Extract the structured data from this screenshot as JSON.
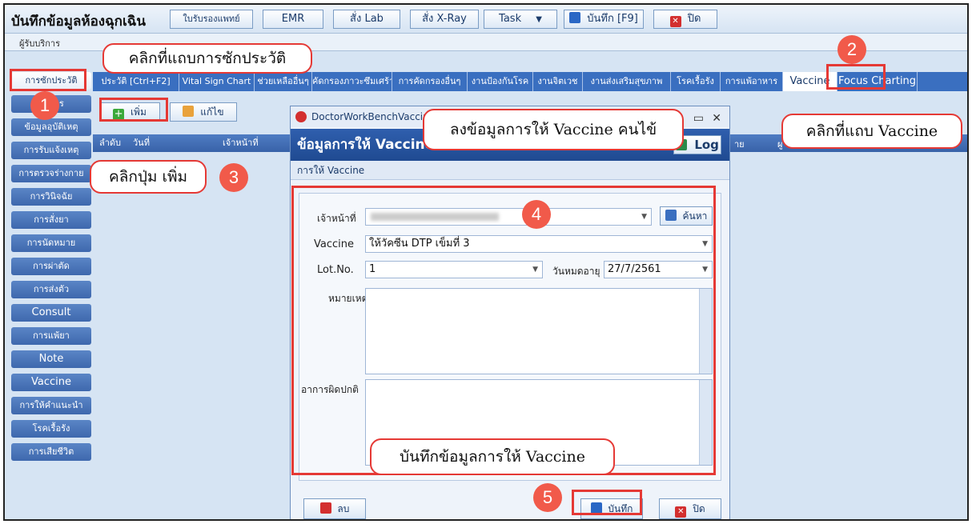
{
  "toolbar": {
    "title": "บันทึกข้อมูลห้องฉุกเฉิน",
    "buttons": [
      "ใบรับรองแพทย์",
      "EMR",
      "สั่ง Lab",
      "สั่ง X-Ray",
      "Task",
      "บันทึก [F9]",
      "ปิด"
    ]
  },
  "subrow": {
    "label": "ผู้รับบริการ"
  },
  "tabs": [
    "ประวัติ [Ctrl+F2]",
    "Vital Sign Chart",
    "ช่วยเหลืออื่นๆ",
    "คัดกรองภาวะซึมเศร้า",
    "การคัดกรองอื่นๆ",
    "งานป้องกันโรค",
    "งานจิตเวช",
    "งานส่งเสริมสุขภาพ",
    "โรคเรื้อรัง",
    "การแพ้อาหาร",
    "Vaccine",
    "Focus Charting"
  ],
  "sidebar": [
    "การซักประวัติ",
    "อาการ",
    "ข้อมูลอุบัติเหตุ",
    "การรับแจ้งเหตุ",
    "การตรวจร่างกาย",
    "การวินิจฉัย",
    "การสั่งยา",
    "การนัดหมาย",
    "การผ่าตัด",
    "การส่งตัว",
    "Consult",
    "การแพ้ยา",
    "Note",
    "Vaccine",
    "การให้คำแนะนำ",
    "โรคเรื้อรัง",
    "การเสียชีวิต"
  ],
  "left_panel": {
    "add_label": "เพิ่ม",
    "edit_label": "แก้ไข",
    "columns": [
      "ลำดับ",
      "วันที่",
      "เจ้าหน้าที่"
    ]
  },
  "dialog": {
    "window_title": "DoctorWorkBenchVaccine",
    "header": "ข้อมูลการให้ Vaccine",
    "log_label": "Log",
    "section": "การให้ Vaccine",
    "staff_label": "เจ้าหน้าที่",
    "search_label": "ค้นหา",
    "vaccine_label": "Vaccine",
    "vaccine_value": "ให้วัคซีน DTP เข็มที่ 3",
    "lot_label": "Lot.No.",
    "lot_value": "1",
    "expiry_label": "วันหมดอายุ",
    "expiry_value": "27/7/2561",
    "note_label": "หมายเหตุ",
    "adverse_label": "อาการผิดปกติ",
    "delete_label": "ลบ",
    "save_label": "บันทึก",
    "close_label": "ปิด"
  },
  "right_panel": {
    "columns": [
      "าย",
      "ผู"
    ]
  },
  "annotations": {
    "callout1": "คลิกที่แถบการซักประวัติ",
    "callout2": "คลิกที่แถบ Vaccine",
    "callout3": "คลิกปุ่ม เพิ่ม",
    "callout4": "ลงข้อมูลการให้ Vaccine คนไข้",
    "callout5": "บันทึกข้อมูลการให้ Vaccine",
    "numbers": [
      "1",
      "2",
      "3",
      "4",
      "5"
    ]
  },
  "colors": {
    "accent": "#e53935",
    "badge": "#f15a4a",
    "tab_bar": "#3a6fc0"
  }
}
